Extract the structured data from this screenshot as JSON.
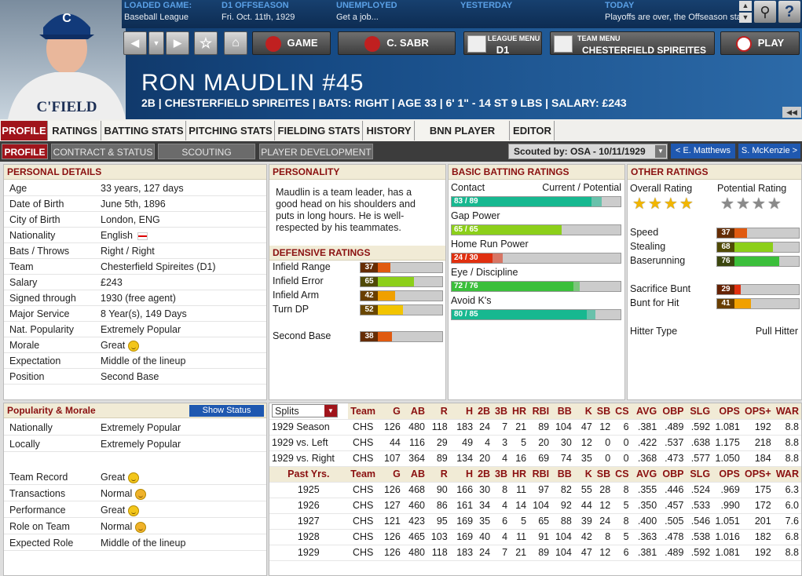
{
  "top": {
    "loaded_game_h": "LOADED GAME:",
    "loaded_game_v": "Baseball League",
    "phase_h": "D1 OFFSEASON",
    "phase_v": "Fri. Oct. 11th, 1929",
    "job_h": "UNEMPLOYED",
    "job_v": "Get a job...",
    "yesterday_h": "YESTERDAY",
    "today_h": "TODAY",
    "today_v": "Playoffs are over, the Offseason starts"
  },
  "nav": {
    "game": "GAME",
    "manager": "C. SABR",
    "league_menu_small": "LEAGUE MENU",
    "league_menu": "D1",
    "team_menu_small": "TEAM MENU",
    "team_menu": "CHESTERFIELD SPIREITES",
    "play": "PLAY"
  },
  "player": {
    "name": "RON MAUDLIN  #45",
    "subtitle": "2B | CHESTERFIELD SPIREITES | BATS: RIGHT | AGE 33 | 6' 1\" - 14 ST 9 LBS | SALARY: £243",
    "cap_letter": "C",
    "jersey": "C'FIELD"
  },
  "tabs": [
    "PROFILE",
    "RATINGS",
    "BATTING STATS",
    "PITCHING STATS",
    "FIELDING STATS",
    "HISTORY",
    "BNN PLAYER PAGE",
    "EDITOR"
  ],
  "subtabs": [
    "PROFILE",
    "CONTRACT & STATUS",
    "SCOUTING REPORTS",
    "PLAYER DEVELOPMENT"
  ],
  "scouting": {
    "label": "Scouted by: OSA - 10/11/1929",
    "prev": "< E. Matthews",
    "next": "S. McKenzie >"
  },
  "personal": {
    "title": "PERSONAL DETAILS",
    "rows": [
      [
        "Age",
        "33 years, 127 days"
      ],
      [
        "Date of Birth",
        "June 5th, 1896"
      ],
      [
        "City of Birth",
        "London, ENG"
      ],
      [
        "Nationality",
        "English"
      ],
      [
        "Bats / Throws",
        "Right / Right"
      ],
      [
        "Team",
        "Chesterfield Spireites (D1)"
      ],
      [
        "Salary",
        "£243"
      ],
      [
        "Signed through",
        "1930 (free agent)"
      ],
      [
        "Major Service",
        "8 Year(s), 149 Days"
      ],
      [
        "Nat. Popularity",
        "Extremely Popular"
      ],
      [
        "Morale",
        "Great"
      ],
      [
        "Expectation",
        "Middle of the lineup"
      ],
      [
        "Position",
        "Second Base"
      ]
    ]
  },
  "personality": {
    "title": "PERSONALITY",
    "text": "Maudlin is a team leader, has a good head on his shoulders and puts in long hours. He is well-respected by his teammates."
  },
  "defensive": {
    "title": "DEFENSIVE RATINGS",
    "items": [
      {
        "label": "Infield Range",
        "value": 37,
        "color": "#e05a10"
      },
      {
        "label": "Infield Error",
        "value": 65,
        "color": "#8ccf1a"
      },
      {
        "label": "Infield Arm",
        "value": 42,
        "color": "#f0a000"
      },
      {
        "label": "Turn DP",
        "value": 52,
        "color": "#f2c400"
      },
      {
        "label": "Second Base",
        "value": 38,
        "color": "#e05a10"
      }
    ]
  },
  "batting": {
    "title": "BASIC BATTING RATINGS",
    "cp_label": "Current / Potential",
    "items": [
      {
        "label": "Contact",
        "text": "83 / 89",
        "cur": 83,
        "pot": 89,
        "color": "#17b890"
      },
      {
        "label": "Gap Power",
        "text": "65 / 65",
        "cur": 65,
        "pot": 65,
        "color": "#8ccf1a"
      },
      {
        "label": "Home Run Power",
        "text": "24 / 30",
        "cur": 24,
        "pot": 30,
        "color": "#e03010"
      },
      {
        "label": "Eye / Discipline",
        "text": "72 / 76",
        "cur": 72,
        "pot": 76,
        "color": "#3bbf3b"
      },
      {
        "label": "Avoid K's",
        "text": "80 / 85",
        "cur": 80,
        "pot": 85,
        "color": "#17b890"
      }
    ]
  },
  "other": {
    "title": "OTHER RATINGS",
    "overall_label": "Overall Rating",
    "potential_label": "Potential Rating",
    "overall_stars": 4,
    "potential_stars": 4,
    "items": [
      {
        "label": "Speed",
        "value": 37,
        "color": "#e05a10"
      },
      {
        "label": "Stealing",
        "value": 68,
        "color": "#8ccf1a"
      },
      {
        "label": "Baserunning",
        "value": 76,
        "color": "#3bbf3b"
      },
      {
        "label": "Sacrifice Bunt",
        "value": 29,
        "color": "#e03010"
      },
      {
        "label": "Bunt for Hit",
        "value": 41,
        "color": "#f0a000"
      }
    ],
    "hitter_type_label": "Hitter Type",
    "hitter_type": "Pull Hitter"
  },
  "popularity": {
    "title": "Popularity & Morale",
    "button": "Show Status",
    "rows": [
      [
        "Nationally",
        "Extremely Popular",
        ""
      ],
      [
        "Locally",
        "Extremely Popular",
        ""
      ],
      [
        "Team Record",
        "Great",
        "great"
      ],
      [
        "Transactions",
        "Normal",
        "normal"
      ],
      [
        "Performance",
        "Great",
        "great"
      ],
      [
        "Role on Team",
        "Normal",
        "normal"
      ],
      [
        "Expected Role",
        "Middle of the lineup",
        ""
      ]
    ]
  },
  "stats": {
    "splits_label": "Splits",
    "header": [
      "Team",
      "G",
      "AB",
      "R",
      "H",
      "2B",
      "3B",
      "HR",
      "RBI",
      "BB",
      "K",
      "SB",
      "CS",
      "AVG",
      "OBP",
      "SLG",
      "OPS",
      "OPS+",
      "WAR"
    ],
    "splits": [
      [
        "1929 Season",
        "CHS",
        "126",
        "480",
        "118",
        "183",
        "24",
        "7",
        "21",
        "89",
        "104",
        "47",
        "12",
        "6",
        ".381",
        ".489",
        ".592",
        "1.081",
        "192",
        "8.8"
      ],
      [
        "1929 vs. Left",
        "CHS",
        "44",
        "116",
        "29",
        "49",
        "4",
        "3",
        "5",
        "20",
        "30",
        "12",
        "0",
        "0",
        ".422",
        ".537",
        ".638",
        "1.175",
        "218",
        "8.8"
      ],
      [
        "1929 vs. Right",
        "CHS",
        "107",
        "364",
        "89",
        "134",
        "20",
        "4",
        "16",
        "69",
        "74",
        "35",
        "0",
        "0",
        ".368",
        ".473",
        ".577",
        "1.050",
        "184",
        "8.8"
      ]
    ],
    "past_label": "Past Yrs.",
    "past": [
      [
        "1925",
        "CHS",
        "126",
        "468",
        "90",
        "166",
        "30",
        "8",
        "11",
        "97",
        "82",
        "55",
        "28",
        "8",
        ".355",
        ".446",
        ".524",
        ".969",
        "175",
        "6.3"
      ],
      [
        "1926",
        "CHS",
        "127",
        "460",
        "86",
        "161",
        "34",
        "4",
        "14",
        "104",
        "92",
        "44",
        "12",
        "5",
        ".350",
        ".457",
        ".533",
        ".990",
        "172",
        "6.0"
      ],
      [
        "1927",
        "CHS",
        "121",
        "423",
        "95",
        "169",
        "35",
        "6",
        "5",
        "65",
        "88",
        "39",
        "24",
        "8",
        ".400",
        ".505",
        ".546",
        "1.051",
        "201",
        "7.6"
      ],
      [
        "1928",
        "CHS",
        "126",
        "465",
        "103",
        "169",
        "40",
        "4",
        "11",
        "91",
        "104",
        "42",
        "8",
        "5",
        ".363",
        ".478",
        ".538",
        "1.016",
        "182",
        "6.8"
      ],
      [
        "1929",
        "CHS",
        "126",
        "480",
        "118",
        "183",
        "24",
        "7",
        "21",
        "89",
        "104",
        "47",
        "12",
        "6",
        ".381",
        ".489",
        ".592",
        "1.081",
        "192",
        "8.8"
      ]
    ]
  }
}
